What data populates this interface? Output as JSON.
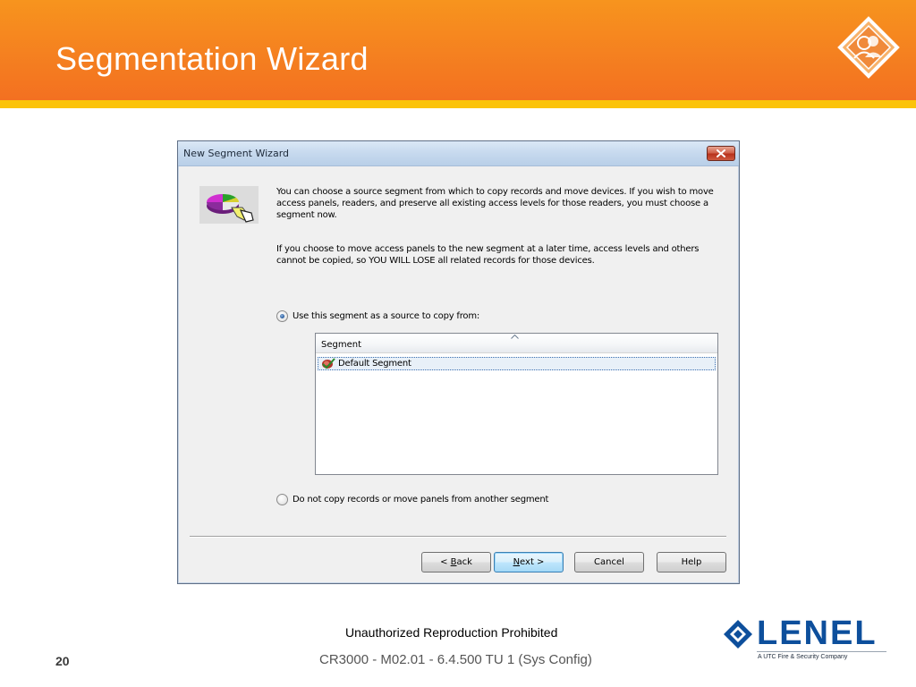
{
  "slide": {
    "title": "Segmentation Wizard",
    "header_color": "#f37021",
    "stripe_color": "#fbc30a"
  },
  "dialog": {
    "title": "New Segment Wizard",
    "close_icon": "close-x-icon",
    "wizard_icon": "pie-chart-hand-icon",
    "paragraph_1": "You can choose a source segment from which to copy records and move devices.  If you wish to move access panels, readers, and preserve all existing access levels for those readers, you must choose a segment now.",
    "paragraph_2": "If you choose to move access panels to the new segment at a later time, access levels and others cannot be copied, so YOU WILL LOSE all related records for those devices.",
    "option_use_source": {
      "label": "Use this segment as a source to copy from:",
      "checked": true
    },
    "segment_list": {
      "column_header": "Segment",
      "rows": [
        {
          "label": "Default Segment",
          "icon": "segment-check-icon",
          "selected": true
        }
      ]
    },
    "option_no_copy": {
      "label": "Do not copy records or move panels from another segment",
      "checked": false
    },
    "buttons": {
      "back_prefix": "< ",
      "back_mnemonic": "B",
      "back_rest": "ack",
      "next_mnemonic": "N",
      "next_rest": "ext >",
      "cancel": "Cancel",
      "help": "Help"
    }
  },
  "footer": {
    "notice": "Unauthorized Reproduction Prohibited",
    "page_number": "20",
    "course": "CR3000 - M02.01 - 6.4.500 TU 1 (Sys Config)",
    "logo_word": "LENEL",
    "logo_subtitle": "A UTC Fire & Security Company",
    "logo_color": "#0d4f9c"
  }
}
